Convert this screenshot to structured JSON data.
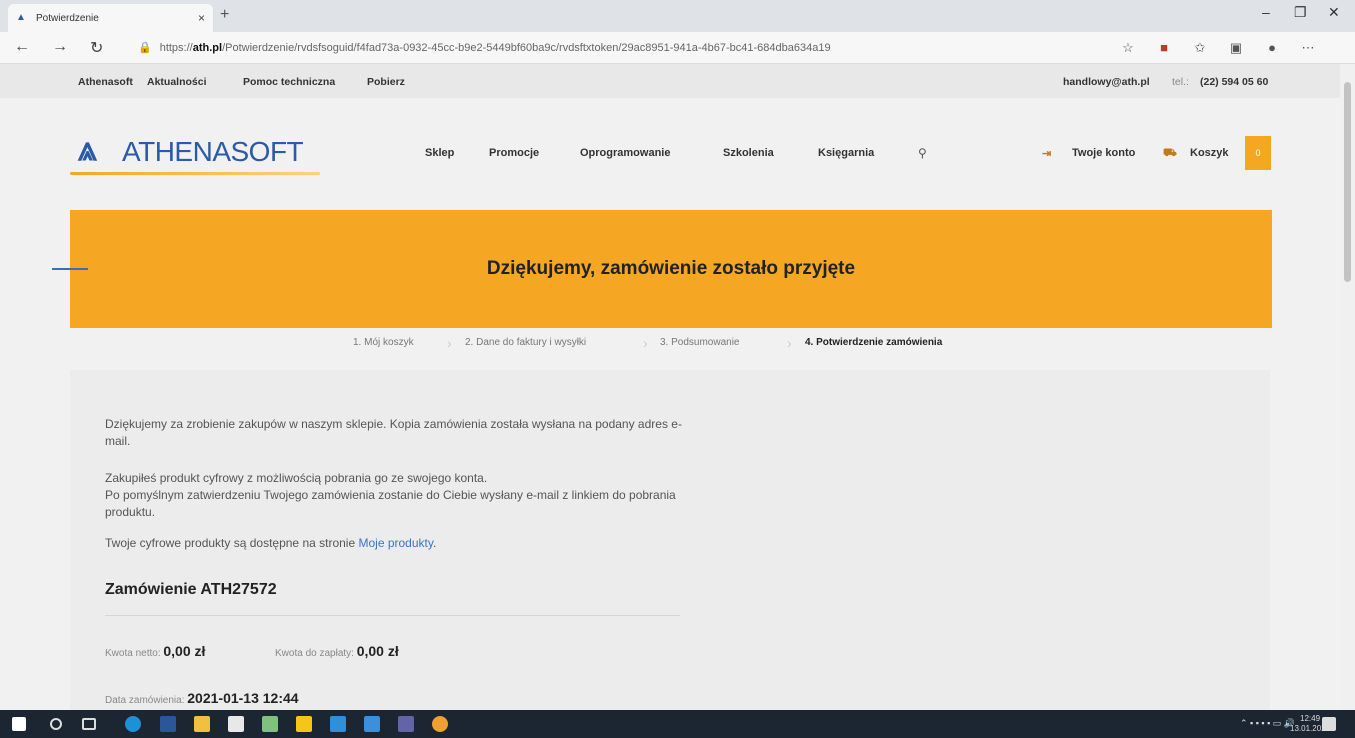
{
  "browser": {
    "tab_title": "Potwierdzenie",
    "tab_close": "×",
    "new_tab": "+",
    "url_prefix": "https://",
    "url_host": "ath.pl",
    "url_path": "/Potwierdzenie/rvdsfsoguid/f4fad73a-0932-45cc-b9e2-5449bf60ba9c/rvdsftxtoken/29ac8951-941a-4b67-bc41-684dba634a19",
    "window_minimize": "–",
    "window_restore": "❐",
    "window_close": "✕"
  },
  "utility": {
    "links": [
      "Athenasoft",
      "Aktualności",
      "Pomoc techniczna",
      "Pobierz"
    ],
    "email": "handlowy@ath.pl",
    "phone_label": "tel.:",
    "phone": "(22) 594 05 60"
  },
  "header": {
    "logo_text": "ATHENASOFT",
    "nav": [
      "Sklep",
      "Promocje",
      "Oprogramowanie",
      "Szkolenia",
      "Księgarnia"
    ],
    "account": "Twoje konto",
    "cart": "Koszyk",
    "cart_count": "0"
  },
  "banner": {
    "title": "Dziękujemy, zamówienie zostało przyjęte"
  },
  "steps": [
    "1. Mój koszyk",
    "2. Dane do faktury i wysyłki",
    "3. Podsumowanie",
    "4. Potwierdzenie zamówienia"
  ],
  "content": {
    "para1": "Dziękujemy za zrobienie zakupów w naszym sklepie. Kopia zamówienia została wysłana na podany adres e-mail.",
    "para2_line1": "Zakupiłeś produkt cyfrowy z możliwością pobrania go ze swojego konta.",
    "para2_line2": "Po pomyślnym zatwierdzeniu Twojego zamówienia zostanie do Ciebie wysłany e-mail z linkiem do pobrania produktu.",
    "para2_line3": "Twoje cyfrowe produkty są dostępne na stronie",
    "my_products_link": "Moje produkty",
    "order_title": "Zamówienie ATH27572",
    "net_label": "Kwota netto:",
    "net_value": "0,00 zł",
    "pay_label": "Kwota do zapłaty:",
    "pay_value": "0,00 zł",
    "date_label": "Data zamówienia:",
    "date_value": "2021-01-13 12:44"
  },
  "taskbar": {
    "time": "12:49",
    "date": "13.01.2021"
  }
}
